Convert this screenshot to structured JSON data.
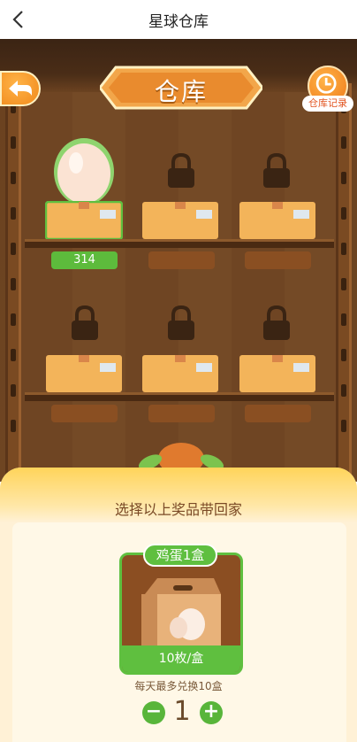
{
  "header": {
    "title": "星球仓库",
    "back_icon": "chevron-left-icon"
  },
  "scene": {
    "banner_title": "仓库",
    "records_label": "仓库记录",
    "shelves": [
      {
        "slots": [
          {
            "state": "egg",
            "count_label": "314",
            "selected": true
          },
          {
            "state": "locked",
            "count_label": ""
          },
          {
            "state": "locked",
            "count_label": ""
          }
        ]
      },
      {
        "slots": [
          {
            "state": "locked",
            "count_label": ""
          },
          {
            "state": "locked",
            "count_label": ""
          },
          {
            "state": "locked",
            "count_label": ""
          }
        ]
      }
    ]
  },
  "prize_panel": {
    "title": "选择以上奖品带回家",
    "card": {
      "tag": "鸡蛋1盒",
      "subtitle": "10枚/盒"
    },
    "limit_text": "每天最多兑换10盒",
    "quantity": "1",
    "minus_symbol": "−",
    "plus_symbol": "+"
  },
  "colors": {
    "accent_green": "#5fbf3f",
    "wood_dark": "#4a2d17",
    "orange": "#f08a1c"
  }
}
